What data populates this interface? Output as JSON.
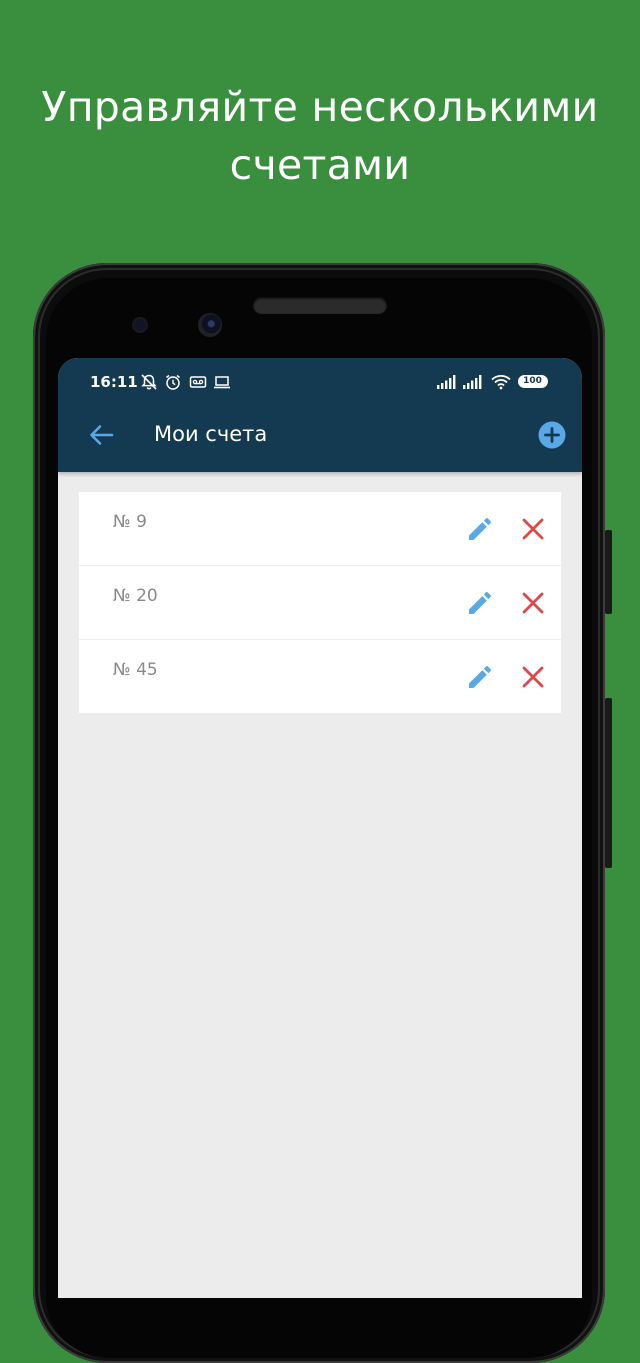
{
  "promo": {
    "title_line1": "Управляйте несколькими",
    "title_line2": "счетами"
  },
  "status_bar": {
    "time": "16:11",
    "battery": "100",
    "icons": [
      "bell-off-icon",
      "alarm-icon",
      "voicemail-icon",
      "laptop-icon",
      "signal-icon",
      "signal-icon",
      "wifi-icon",
      "battery-icon"
    ]
  },
  "appbar": {
    "title": "Мои счета",
    "back_icon": "arrow-left-icon",
    "add_icon": "plus-circle-icon"
  },
  "accounts": [
    {
      "label": "№ 9"
    },
    {
      "label": "№ 20"
    },
    {
      "label": "№ 45"
    }
  ],
  "colors": {
    "background": "#3a8f3e",
    "appbar": "#143a52",
    "accent": "#5aa8e6",
    "delete": "#e04848",
    "screen": "#ececec"
  }
}
